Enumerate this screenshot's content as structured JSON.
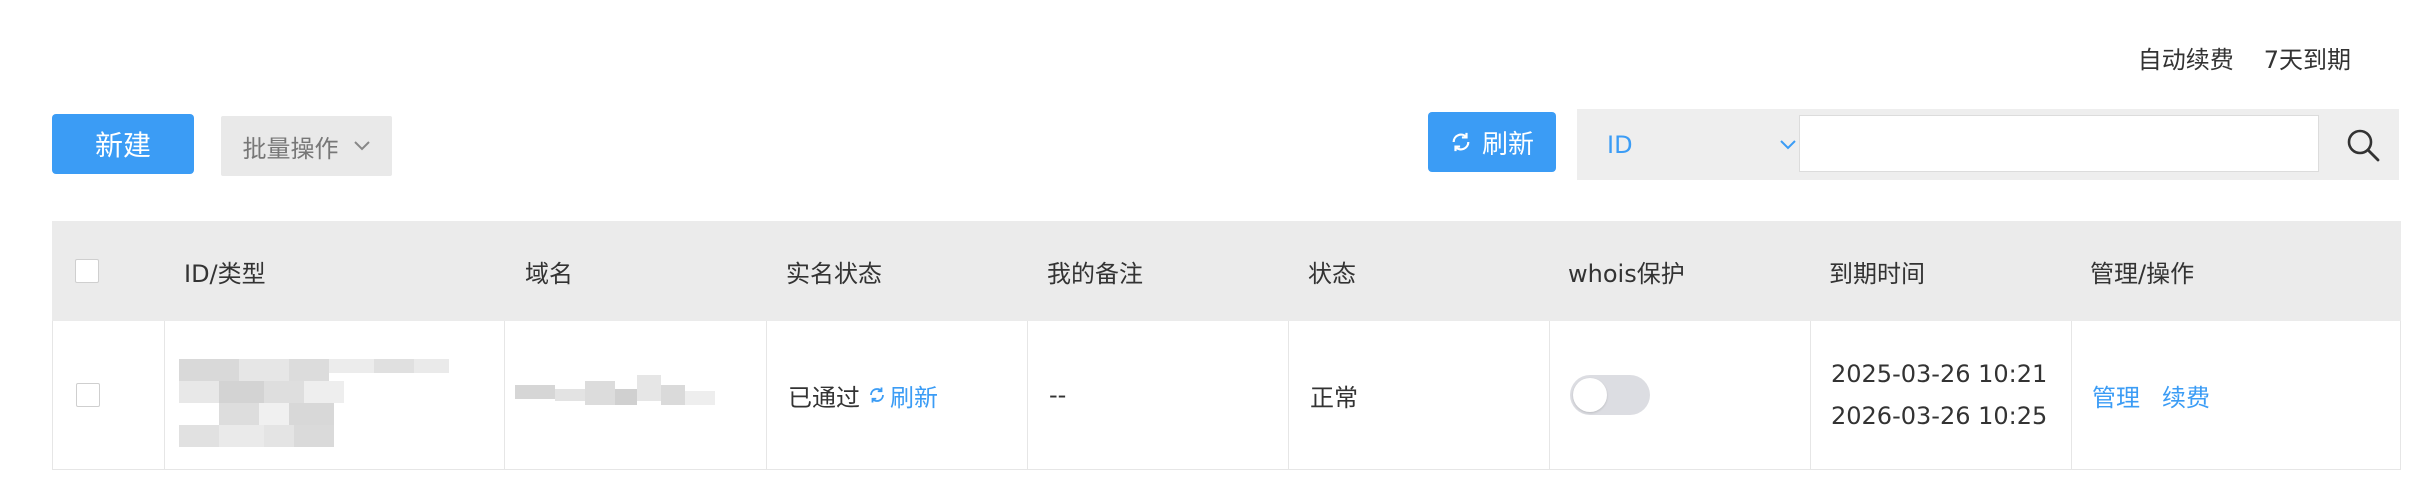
{
  "top_links": {
    "auto_renew": "自动续费",
    "expire_7d": "7天到期"
  },
  "toolbar": {
    "new_label": "新建",
    "batch_label": "批量操作",
    "refresh_label": "刷新",
    "search_select_value": "ID",
    "search_placeholder": ""
  },
  "table": {
    "headers": [
      "ID/类型",
      "域名",
      "实名状态",
      "我的备注",
      "状态",
      "whois保护",
      "到期时间",
      "管理/操作"
    ],
    "rows": [
      {
        "realname_status": "已通过",
        "realname_refresh": "刷新",
        "note": "--",
        "status": "正常",
        "whois_protection_on": false,
        "date1": "2025-03-26 10:21",
        "date2": "2026-03-26 10:25",
        "action_manage": "管理",
        "action_renew": "续费"
      }
    ]
  },
  "colors": {
    "accent": "#3b9cf5",
    "header_bg": "#ebebeb",
    "toggle_off": "#dcdde2"
  }
}
